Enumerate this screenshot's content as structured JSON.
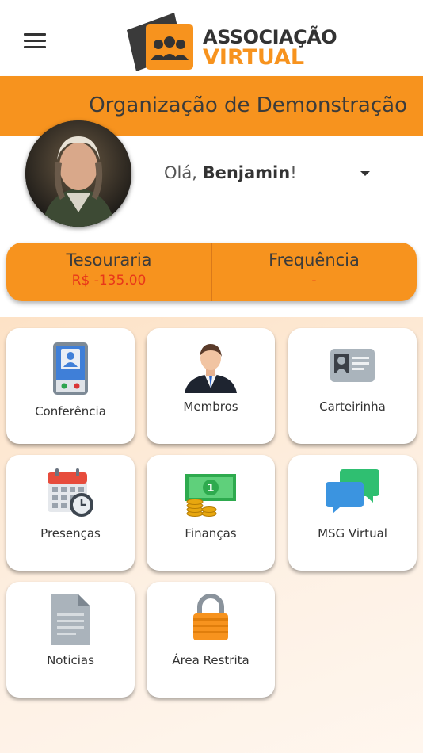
{
  "app": {
    "logo_line1": "ASSOCIAÇÃO",
    "logo_line2": "VIRTUAL",
    "brand_color": "#f7931e"
  },
  "organization": {
    "name": "Organização de Demonstração"
  },
  "user": {
    "greeting_prefix": "Olá, ",
    "name": "Benjamin",
    "greeting_suffix": "!"
  },
  "stats": {
    "treasury_label": "Tesouraria",
    "treasury_value": "R$ -135.00",
    "attendance_label": "Frequência",
    "attendance_value": "-"
  },
  "tiles": [
    {
      "label": "Conferência",
      "icon": "phone-call-icon"
    },
    {
      "label": "Membros",
      "icon": "member-icon"
    },
    {
      "label": "Carteirinha",
      "icon": "id-card-icon"
    },
    {
      "label": "Presenças",
      "icon": "calendar-clock-icon"
    },
    {
      "label": "Finanças",
      "icon": "money-icon"
    },
    {
      "label": "MSG Virtual",
      "icon": "chat-bubbles-icon"
    },
    {
      "label": "Noticias",
      "icon": "document-icon"
    },
    {
      "label": "Área Restrita",
      "icon": "padlock-icon"
    }
  ]
}
